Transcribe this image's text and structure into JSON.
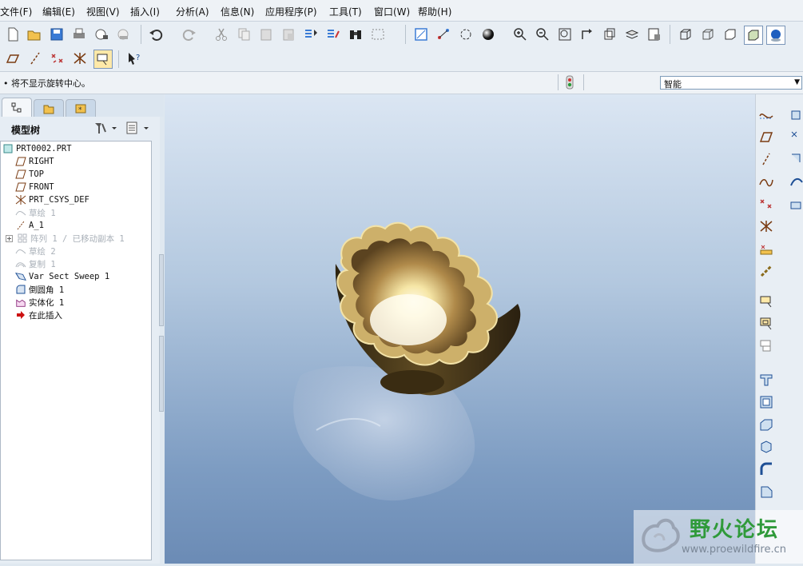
{
  "menu": [
    {
      "label": "文件(F)"
    },
    {
      "label": "编辑(E)"
    },
    {
      "label": "视图(V)"
    },
    {
      "label": "插入(I)"
    },
    {
      "label": "分析(A)"
    },
    {
      "label": "信息(N)"
    },
    {
      "label": "应用程序(P)"
    },
    {
      "label": "工具(T)"
    },
    {
      "label": "窗口(W)"
    },
    {
      "label": "帮助(H)"
    }
  ],
  "status": {
    "message": "• 将不显示旋转中心。",
    "filter_value": "智能"
  },
  "left_panel": {
    "title": "模型树"
  },
  "tree": [
    {
      "label": "PRT0002.PRT",
      "icon": "part-icon",
      "dim": false
    },
    {
      "label": "RIGHT",
      "icon": "datum-plane-icon",
      "dim": false
    },
    {
      "label": "TOP",
      "icon": "datum-plane-icon",
      "dim": false
    },
    {
      "label": "FRONT",
      "icon": "datum-plane-icon",
      "dim": false
    },
    {
      "label": "PRT_CSYS_DEF",
      "icon": "csys-icon",
      "dim": false
    },
    {
      "label": "草绘 1",
      "icon": "sketch-icon",
      "dim": true
    },
    {
      "label": "A_1",
      "icon": "axis-icon",
      "dim": false
    },
    {
      "label": "阵列 1 / 已移动副本 1",
      "icon": "pattern-icon",
      "dim": true
    },
    {
      "label": "草绘 2",
      "icon": "sketch-icon",
      "dim": true
    },
    {
      "label": "复制 1",
      "icon": "copy-icon",
      "dim": true
    },
    {
      "label": "Var Sect Sweep 1",
      "icon": "sweep-icon",
      "dim": false
    },
    {
      "label": "倒圆角 1",
      "icon": "round-icon",
      "dim": false
    },
    {
      "label": "实体化 1",
      "icon": "solidify-icon",
      "dim": false
    },
    {
      "label": "在此插入",
      "icon": "insert-here-arrow-icon",
      "dim": false
    }
  ],
  "watermark": {
    "title": "野火论坛",
    "url": "www.proewildfire.cn"
  },
  "colors": {
    "accent": "#3a7bd5",
    "viewport_top": "#dbe6f3",
    "viewport_bottom": "#6b8bb5",
    "bowl": "#7a5a28"
  }
}
